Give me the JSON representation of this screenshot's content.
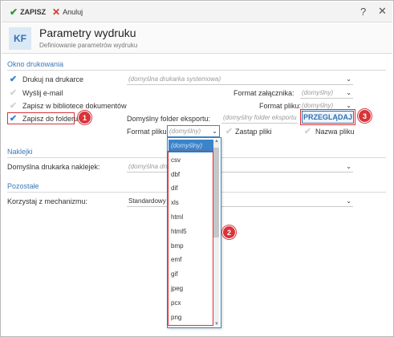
{
  "toolbar": {
    "save_label": "ZAPISZ",
    "cancel_label": "Anuluj",
    "help": "?",
    "close": "✕"
  },
  "header": {
    "logo": "KF",
    "title": "Parametry wydruku",
    "subtitle": "Definiowanie parametrów wydruku"
  },
  "sections": {
    "okno": "Okno drukowania",
    "naklejki": "Naklejki",
    "pozostale": "Pozostałe"
  },
  "okno": {
    "drukuj_label": "Drukuj na drukarce",
    "drukuj_value": "(domyślna drukarka systemowa)",
    "email_label": "Wyślij e-mail",
    "format_zal_label": "Format załącznika:",
    "format_zal_value": "(domyślny)",
    "zapisz_bib_label": "Zapisz w bibliotece dokumentów",
    "format_pliku_label": "Format pliku:",
    "format_pliku_value": "(domyślny)",
    "zapisz_folder_label": "Zapisz do folderu",
    "folder_eksportu_label": "Domyślny folder eksportu:",
    "folder_eksportu_placeholder": "(domyślny folder eksportu",
    "przegladaj_label": "PRZEGLĄDAJ",
    "format_pliku2_label": "Format pliku:",
    "format_pliku2_value": "(domyślny)",
    "zastap_label": "Zastąp pliki",
    "nazwa_label": "Nazwa pliku"
  },
  "naklejki": {
    "drukarka_label": "Domyślna drukarka naklejek:",
    "drukarka_value": "(domyślna drukarka systemowa)"
  },
  "pozostale": {
    "mechanizm_label": "Korzystaj z mechanizmu:",
    "mechanizm_value": "Standardowy"
  },
  "dropdown": {
    "items": [
      "(domyślny)",
      "csv",
      "dbf",
      "dif",
      "xls",
      "html",
      "html5",
      "bmp",
      "emf",
      "gif",
      "jpeg",
      "pcx",
      "png"
    ]
  },
  "badges": {
    "b1": "1",
    "b2": "2",
    "b3": "3"
  },
  "icons": {
    "check": "check-icon",
    "cancel": "x-icon",
    "arrow": "chevron-down-icon"
  },
  "colors": {
    "accent": "#3a84c9",
    "callout": "#d9333a",
    "check": "#2e9b2e",
    "section": "#3a7ab8"
  }
}
